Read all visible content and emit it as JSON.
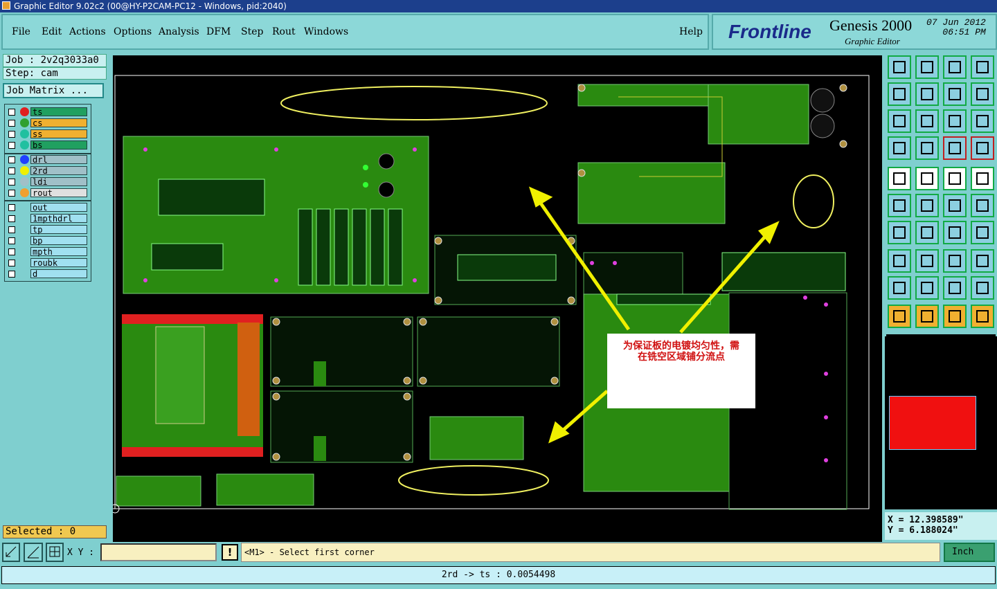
{
  "window": {
    "title": "Graphic Editor 9.02c2 (00@HY-P2CAM-PC12 - Windows, pid:2040)"
  },
  "menu": [
    "File",
    "Edit",
    "Actions",
    "Options",
    "Analysis",
    "DFM",
    "Step",
    "Rout",
    "Windows"
  ],
  "help": "Help",
  "brand": {
    "logo": "Frontline",
    "product": "Genesis 2000",
    "subtitle": "Graphic Editor",
    "date": "07 Jun 2012",
    "time": "06:51 PM"
  },
  "job": {
    "job_label": "Job : 2v2q3033a0",
    "step_label": "Step: cam",
    "matrix_button": "Job Matrix ..."
  },
  "layers": [
    {
      "name": "ts",
      "color": "#e02020",
      "bg": "#20a060"
    },
    {
      "name": "cs",
      "color": "#30a030",
      "bg": "#f0b030"
    },
    {
      "name": "ss",
      "color": "#20c0a0",
      "bg": "#f0b030"
    },
    {
      "name": "bs",
      "color": "#20c0a0",
      "bg": "#20a060"
    },
    {
      "name": "drl",
      "color": "#2040ff",
      "bg": "#a0c0c8"
    },
    {
      "name": "2rd",
      "color": "#f0f000",
      "bg": "#a0c0c8"
    },
    {
      "name": "ldi",
      "color": "#a0c0c8",
      "bg": "#a0c0c8"
    },
    {
      "name": "rout",
      "color": "#f0a030",
      "bg": "#e0e0e0"
    },
    {
      "name": "out",
      "color": "",
      "bg": "#a0e0f0"
    },
    {
      "name": "1mpthdrl",
      "color": "",
      "bg": "#a0e0f0"
    },
    {
      "name": "tp",
      "color": "",
      "bg": "#a0e0f0"
    },
    {
      "name": "bp",
      "color": "",
      "bg": "#a0e0f0"
    },
    {
      "name": "mpth",
      "color": "",
      "bg": "#a0e0f0"
    },
    {
      "name": "roubk",
      "color": "",
      "bg": "#a0e0f0"
    },
    {
      "name": "d",
      "color": "",
      "bg": "#a0e0f0"
    }
  ],
  "selected": "Selected : 0",
  "annotation": {
    "line1": "为保证板的电镀均匀性，需",
    "line2": "在铣空区域铺分流点"
  },
  "coords": {
    "x": "X  =  12.398589\"",
    "y": "Y  =  6.188024\""
  },
  "status": {
    "xy_label": "X Y :",
    "xy_value": "",
    "prompt": "<M1> - Select first corner",
    "units": "Inch"
  },
  "info": "2rd -> ts : 0.0054498",
  "colors": {
    "accent": "#7fcfcf",
    "highlight": "#e02020"
  }
}
